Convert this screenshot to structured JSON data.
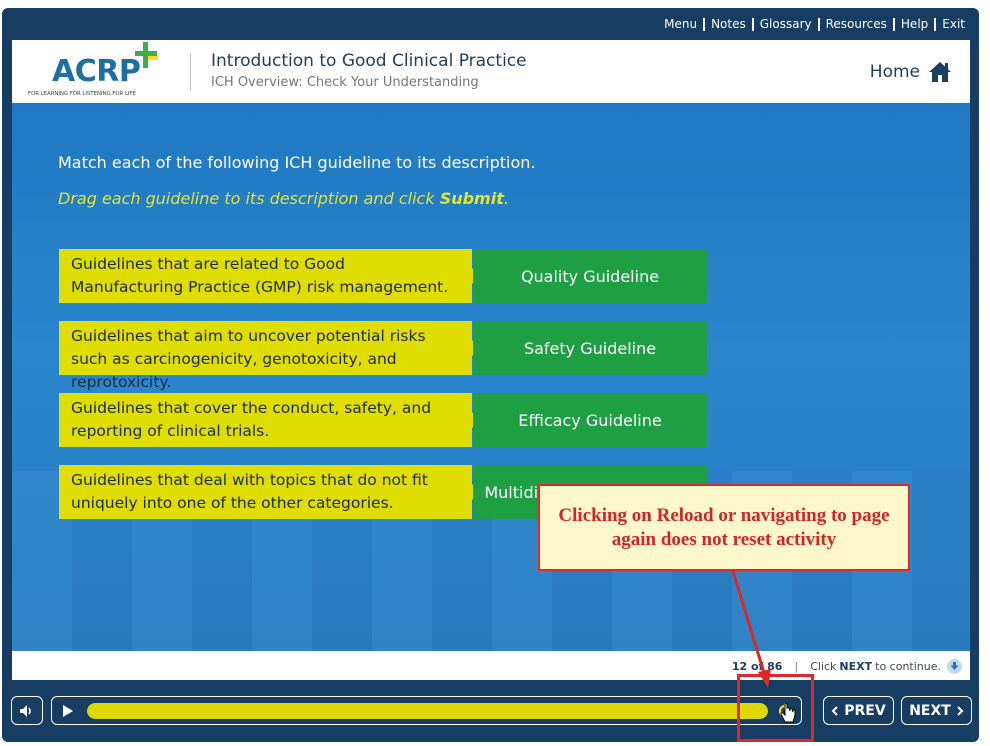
{
  "topnav": {
    "items": [
      "Menu",
      "Notes",
      "Glossary",
      "Resources",
      "Help",
      "Exit"
    ]
  },
  "header": {
    "logo_text": "ACRP",
    "logo_tagline": "FOR LEARNING  FOR LISTENING  FOR LIFE",
    "course_title": "Introduction to Good Clinical Practice",
    "course_subtitle": "ICH Overview: Check Your Understanding",
    "home_label": "Home",
    "home_icon": "home-icon"
  },
  "activity": {
    "instruction": "Match each of the following ICH guideline to its description.",
    "hint_prefix": "Drag each guideline to its description and click ",
    "hint_bold": "Submit",
    "hint_suffix": ".",
    "pairs": [
      {
        "description": "Guidelines that are related to Good Manufacturing Practice (GMP) risk management.",
        "guideline": "Quality Guideline"
      },
      {
        "description": "Guidelines that aim to uncover potential risks such as carcinogenicity, genotoxicity, and reprotoxicity.",
        "guideline": "Safety Guideline"
      },
      {
        "description": "Guidelines that cover the conduct, safety, and reporting of clinical trials.",
        "guideline": "Efficacy Guideline"
      },
      {
        "description": "Guidelines that deal with topics that do not fit uniquely into one of the other categories.",
        "guideline": "Multidisciplinary Guideline"
      }
    ]
  },
  "annotation": {
    "callout_text": "Clicking on Reload or navigating to page again does not reset activity"
  },
  "status": {
    "page_count": "12 of 86",
    "separator": "|",
    "continue_prefix": "Click",
    "continue_bold": "NEXT",
    "continue_suffix": "to continue."
  },
  "controls": {
    "volume_icon": "volume-icon",
    "play_icon": "play-icon",
    "reload_icon": "reload-icon",
    "progress_fraction": 1.0,
    "prev_label": "PREV",
    "next_label": "NEXT"
  },
  "colors": {
    "frame": "#173e62",
    "stage_blue": "#2a86cd",
    "description_yellow": "#dfde00",
    "guideline_green": "#1e9f43",
    "callout_red": "#d92a2a",
    "callout_bg": "#fdf8cc"
  }
}
